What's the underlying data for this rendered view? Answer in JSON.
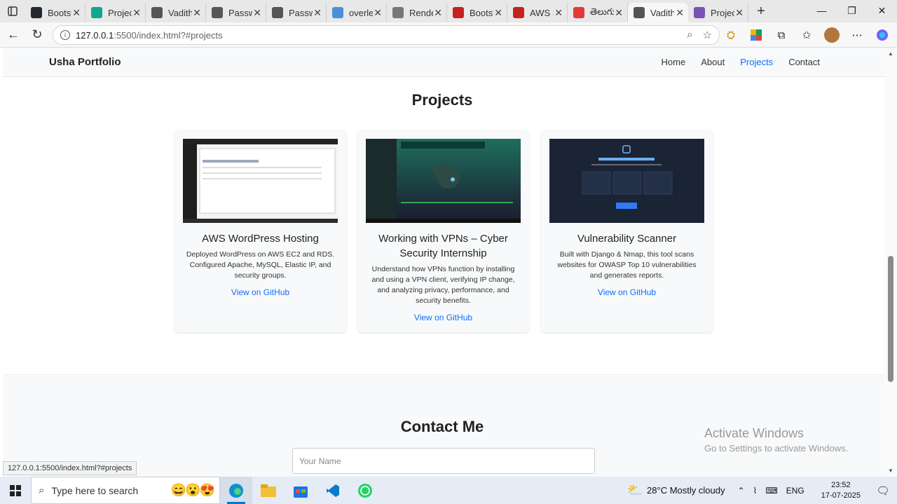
{
  "browser": {
    "tabs": [
      {
        "title": "Bootstrap",
        "icon": "github-icon",
        "color": "#24292f"
      },
      {
        "title": "Projects",
        "icon": "diamond-icon",
        "color": "#12a58f"
      },
      {
        "title": "Vaditha",
        "icon": "globe-icon",
        "color": "#555"
      },
      {
        "title": "Password",
        "icon": "globe-icon",
        "color": "#555"
      },
      {
        "title": "Password",
        "icon": "globe-icon",
        "color": "#555"
      },
      {
        "title": "overleaf",
        "icon": "search-icon",
        "color": "#4a90d9"
      },
      {
        "title": "Render",
        "icon": "render-icon",
        "color": "#777"
      },
      {
        "title": "Bootstrap",
        "icon": "pdf-icon",
        "color": "#c5221f"
      },
      {
        "title": "AWS S",
        "icon": "pdf-icon",
        "color": "#c5221f"
      },
      {
        "title": "తెలుగు",
        "icon": "youtube-icon",
        "color": "#e53935"
      },
      {
        "title": "Vaditha",
        "icon": "globe-icon",
        "color": "#555"
      },
      {
        "title": "Projects",
        "icon": "bootstrap-icon",
        "color": "#7952b3"
      }
    ],
    "active_tab": 10,
    "url_host": "127.0.0.1",
    "url_rest": ":5500/index.html?#projects",
    "status_url": "127.0.0.1:5500/index.html?#projects"
  },
  "page": {
    "brand": "Usha Portfolio",
    "nav": [
      "Home",
      "About",
      "Projects",
      "Contact"
    ],
    "active_nav": "Projects",
    "projects_heading": "Projects",
    "projects": [
      {
        "title": "AWS WordPress Hosting",
        "description": "Deployed WordPress on AWS EC2 and RDS. Configured Apache, MySQL, Elastic IP, and security groups.",
        "link": "View on GitHub"
      },
      {
        "title": "Working with VPNs – Cyber Security Internship",
        "description": "Understand how VPNs function by installing and using a VPN client, verifying IP change, and analyzing privacy, performance, and security benefits.",
        "link": "View on GitHub"
      },
      {
        "title": "Vulnerability Scanner",
        "description": "Built with Django & Nmap, this tool scans websites for OWASP Top 10 vulnerabilities and generates reports.",
        "link": "View on GitHub"
      }
    ],
    "contact_heading": "Contact Me",
    "name_placeholder": "Your Name"
  },
  "windows": {
    "activate_title": "Activate Windows",
    "activate_sub": "Go to Settings to activate Windows.",
    "search_placeholder": "Type here to search",
    "weather": "28°C  Mostly cloudy",
    "lang": "ENG",
    "time": "23:52",
    "date": "17-07-2025"
  }
}
